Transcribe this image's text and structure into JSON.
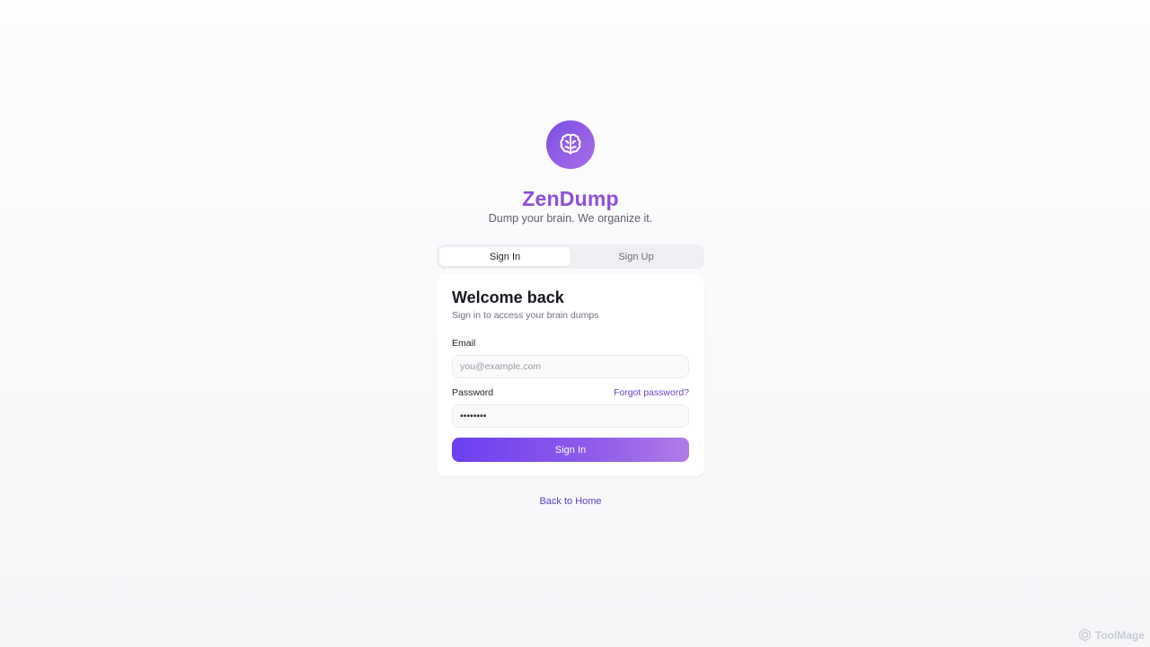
{
  "brand": {
    "name": "ZenDump",
    "tagline": "Dump your brain. We organize it.",
    "logo_icon": "brain-icon",
    "accent_color": "#8e4fd9"
  },
  "tabs": [
    {
      "label": "Sign In",
      "active": true
    },
    {
      "label": "Sign Up",
      "active": false
    }
  ],
  "card": {
    "title": "Welcome back",
    "subtitle": "Sign in to access your brain dumps"
  },
  "form": {
    "email_label": "Email",
    "email_placeholder": "you@example.com",
    "email_value": "",
    "password_label": "Password",
    "password_value": "••••••••",
    "forgot_label": "Forgot password?",
    "submit_label": "Sign In"
  },
  "back_link": "Back to Home",
  "watermark": {
    "text": "ToolMage",
    "icon": "hexagon-logo-icon"
  }
}
